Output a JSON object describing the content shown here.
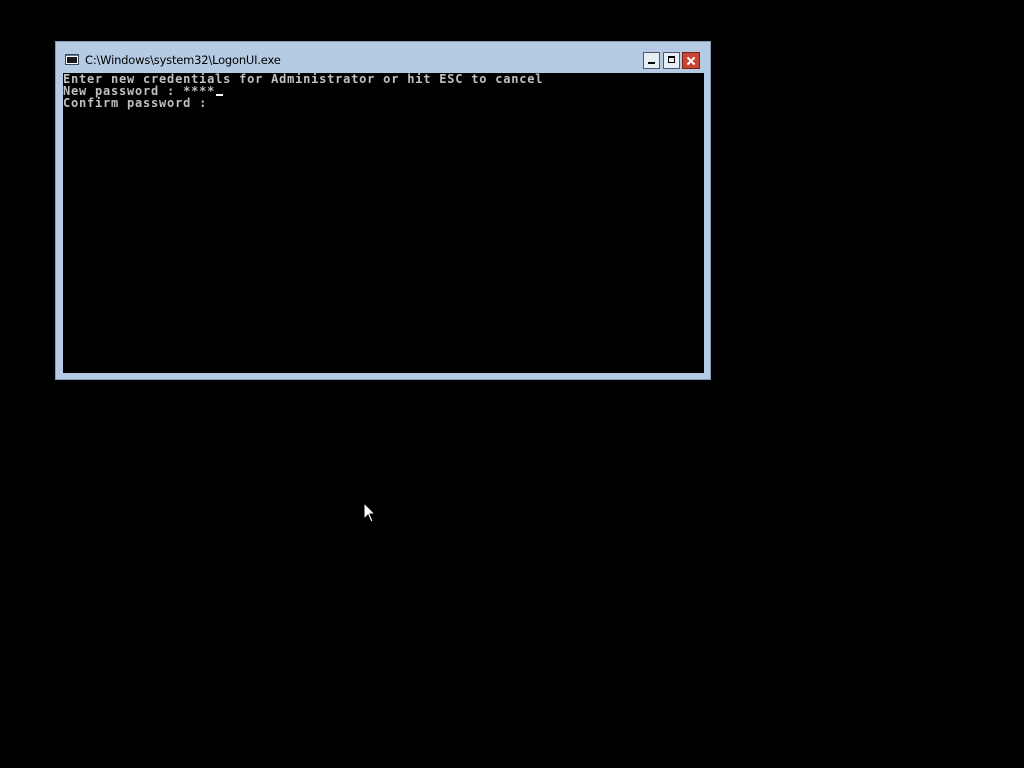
{
  "window": {
    "title": "C:\\Windows\\system32\\LogonUI.exe",
    "icon": "console-app-icon",
    "controls": [
      "minimize-icon",
      "maximize-icon",
      "close-icon"
    ]
  },
  "console": {
    "prompt_line": "Enter new credentials for Administrator or hit ESC to cancel",
    "new_password_label": "New password : ",
    "new_password_value": "****",
    "confirm_password_label": "Confirm password : ",
    "confirm_password_value": ""
  },
  "colors": {
    "background": "#000000",
    "window_frame": "#b4cbe3",
    "console_text": "#c0c0c0",
    "close_button": "#c84535"
  },
  "pointer": {
    "icon": "mouse-pointer-icon"
  }
}
